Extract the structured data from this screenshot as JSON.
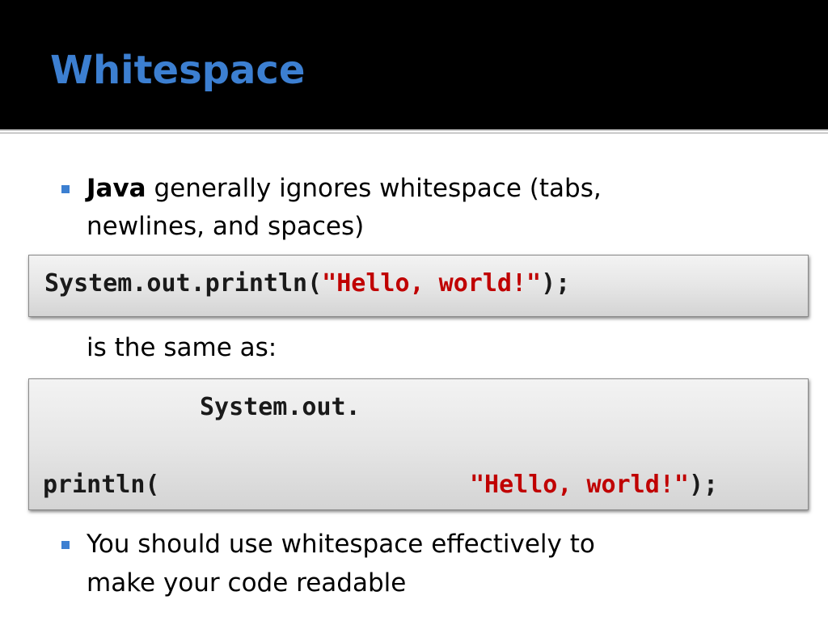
{
  "slide": {
    "title": "Whitespace",
    "accent_color": "#3c7fd1",
    "string_color": "#c00000"
  },
  "bullet1": {
    "bold": "Java",
    "line1_rest": " generally ignores whitespace (tabs,",
    "line2": "newlines, and spaces)"
  },
  "code1": {
    "prefix": "System.out.println(",
    "string": "\"Hello, world!\"",
    "suffix": ");"
  },
  "same_as": "is the same as:",
  "code2": {
    "line1": "System.out.",
    "line2_prefix": "println(",
    "line2_string": "\"Hello, world!\"",
    "line2_suffix": ");"
  },
  "bullet2": {
    "line1": "You should use whitespace effectively to",
    "line2": "make your code readable"
  }
}
